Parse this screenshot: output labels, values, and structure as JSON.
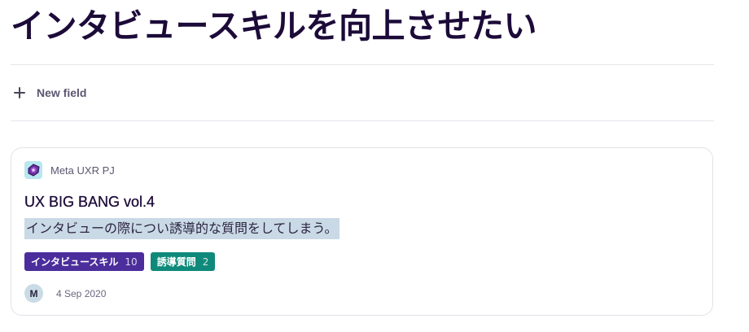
{
  "page": {
    "title": "インタビュースキルを向上させたい",
    "new_field_label": "New field"
  },
  "card": {
    "project": {
      "name": "Meta UXR PJ",
      "icon": "project-logo-icon",
      "icon_bg": "#b8e7ef"
    },
    "title": "UX BIG BANG vol.4",
    "description": "インタビューの際につい誘導的な質問をしてしまう。",
    "tags": [
      {
        "label": "インタビュースキル",
        "count": "10",
        "color": "#4b2d9c"
      },
      {
        "label": "誘導質問",
        "count": "2",
        "color": "#0f8a7a"
      }
    ],
    "author_initial": "M",
    "date": "4 Sep 2020"
  }
}
